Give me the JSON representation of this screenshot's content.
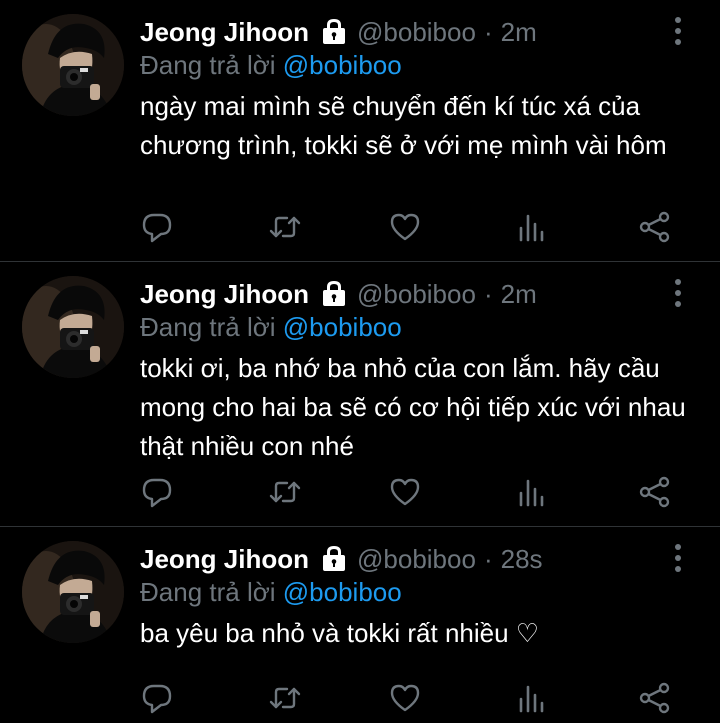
{
  "colors": {
    "background": "#000000",
    "text": "#ffffff",
    "muted": "#6e767d",
    "link": "#1d9bf0",
    "divider": "#2f3336"
  },
  "icons": {
    "lock": "lock-icon",
    "more": "more-vertical-icon",
    "reply": "reply-icon",
    "retweet": "retweet-icon",
    "like": "heart-icon",
    "views": "analytics-icon",
    "share": "share-icon"
  },
  "tweets": [
    {
      "name": "Jeong Jihoon",
      "handle": "@bobiboo",
      "separator": "·",
      "time": "2m",
      "replying_prefix": "Đang trả lời ",
      "replying_to": "@bobiboo",
      "text": "ngày mai mình sẽ chuyển đến kí túc xá của chương trình, tokki sẽ ở với mẹ mình vài hôm"
    },
    {
      "name": "Jeong Jihoon",
      "handle": "@bobiboo",
      "separator": "·",
      "time": "2m",
      "replying_prefix": "Đang trả lời ",
      "replying_to": "@bobiboo",
      "text": "tokki ơi, ba nhớ ba nhỏ của con lắm. hãy cầu mong cho hai ba sẽ có cơ hội tiếp xúc với nhau thật nhiều con nhé"
    },
    {
      "name": "Jeong Jihoon",
      "handle": "@bobiboo",
      "separator": "·",
      "time": "28s",
      "replying_prefix": "Đang trả lời ",
      "replying_to": "@bobiboo",
      "text": "ba yêu ba nhỏ và tokki rất nhiều ♡"
    }
  ]
}
